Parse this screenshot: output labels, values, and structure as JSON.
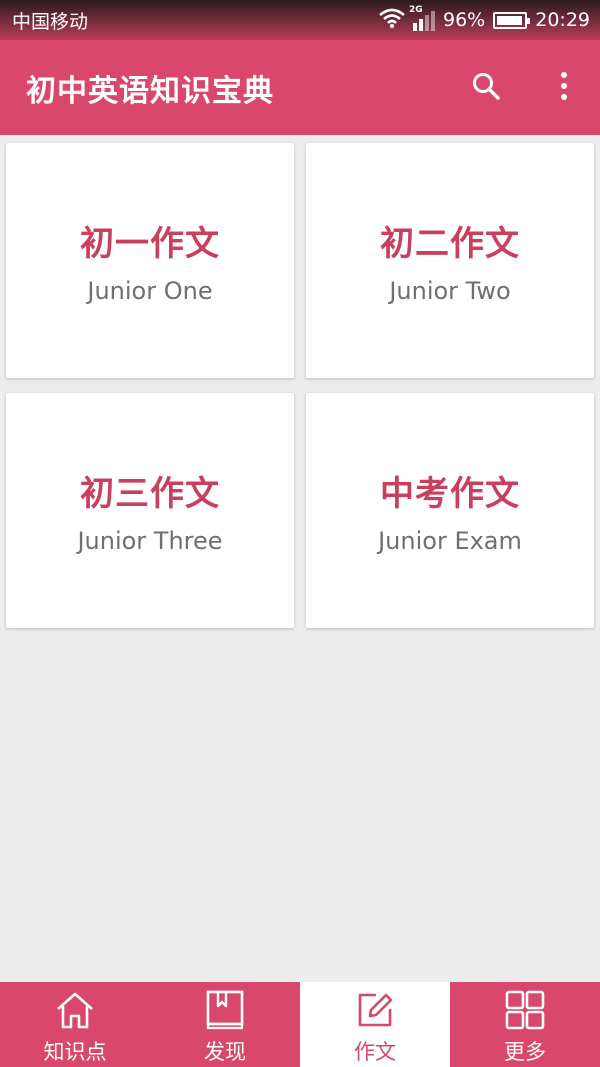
{
  "status_bar": {
    "carrier": "中国移动",
    "network": "2G",
    "battery": "96%",
    "battery_level": 0.96,
    "time": "20:29"
  },
  "app_bar": {
    "title": "初中英语知识宝典",
    "icons": [
      "search-icon",
      "more-vert-icon"
    ]
  },
  "cards": [
    {
      "title": "初一作文",
      "subtitle": "Junior One"
    },
    {
      "title": "初二作文",
      "subtitle": "Junior Two"
    },
    {
      "title": "初三作文",
      "subtitle": "Junior Three"
    },
    {
      "title": "中考作文",
      "subtitle": "Junior Exam"
    }
  ],
  "bottom_nav": {
    "items": [
      {
        "label": "知识点",
        "icon": "home-icon"
      },
      {
        "label": "发现",
        "icon": "book-icon"
      },
      {
        "label": "作文",
        "icon": "edit-icon"
      },
      {
        "label": "更多",
        "icon": "grid-icon"
      }
    ],
    "active_index": 2
  },
  "colors": {
    "primary": "#d9486a",
    "card_title": "#c9405f",
    "card_subtitle": "#6f6f6f",
    "background": "#ededed"
  }
}
